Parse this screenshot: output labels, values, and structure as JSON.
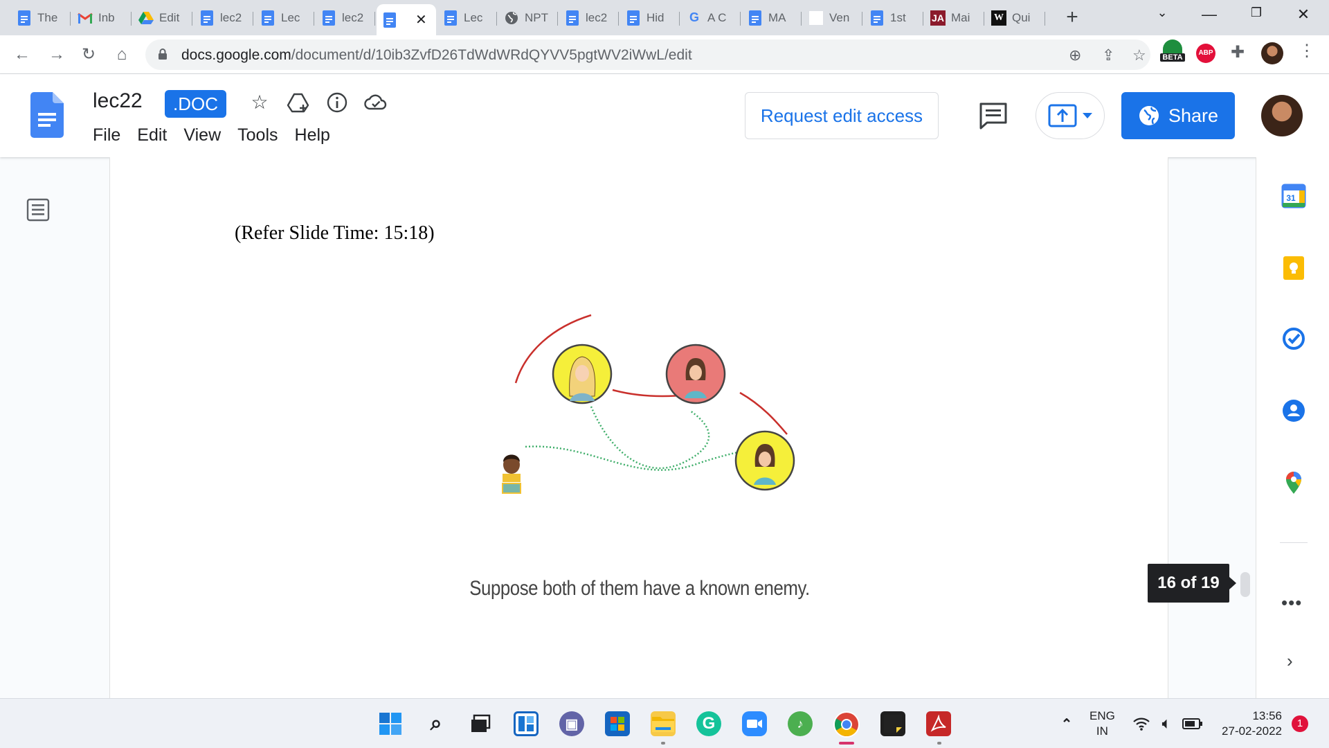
{
  "browser": {
    "tabs": [
      {
        "title": "The",
        "favicon": "docs-icon"
      },
      {
        "title": "Inb",
        "favicon": "gmail-icon"
      },
      {
        "title": "Edit",
        "favicon": "drive-icon"
      },
      {
        "title": "lec2",
        "favicon": "docs-icon"
      },
      {
        "title": "Lec",
        "favicon": "docs-icon"
      },
      {
        "title": "lec2",
        "favicon": "docs-icon"
      },
      {
        "title": "",
        "favicon": "docs-icon",
        "active": true
      },
      {
        "title": "Lec",
        "favicon": "docs-icon"
      },
      {
        "title": "NPT",
        "favicon": "globe-icon"
      },
      {
        "title": "lec2",
        "favicon": "docs-icon"
      },
      {
        "title": "Hid",
        "favicon": "docs-icon"
      },
      {
        "title": "A C",
        "favicon": "google-icon"
      },
      {
        "title": "MA",
        "favicon": "docs-icon"
      },
      {
        "title": "Ven",
        "favicon": "blank-icon"
      },
      {
        "title": "1st",
        "favicon": "docs-icon"
      },
      {
        "title": "Mai",
        "favicon": "ja-icon",
        "badge": "JA"
      },
      {
        "title": "Qui",
        "favicon": "w-icon",
        "badge": "W"
      }
    ],
    "close_glyph": "✕",
    "new_tab_glyph": "+",
    "url_domain": "docs.google.com",
    "url_path": "/document/d/10ib3ZvfD26TdWdWRdQYVV5pgtWV2iWwL/edit",
    "beta_label": "BETA",
    "abp_label": "ABP"
  },
  "docs": {
    "title": "lec22",
    "badge": ".DOC",
    "menu": [
      "File",
      "Edit",
      "View",
      "Tools",
      "Help"
    ],
    "request_edit_label": "Request edit access",
    "share_label": "Share"
  },
  "document": {
    "slide_time": "(Refer Slide Time: 15:18)",
    "caption": "Suppose both of them have a known enemy.",
    "page_indicator": "16 of 19"
  },
  "colors": {
    "accent": "#1a73e8",
    "friend_line": "#c9302c",
    "enemy_line": "#3fae6a",
    "yellow_node": "#f5ef3a",
    "red_node": "#e97a78"
  },
  "taskbar": {
    "lang_top": "ENG",
    "lang_bottom": "IN",
    "time": "13:56",
    "date": "27-02-2022",
    "notifications": "1"
  }
}
